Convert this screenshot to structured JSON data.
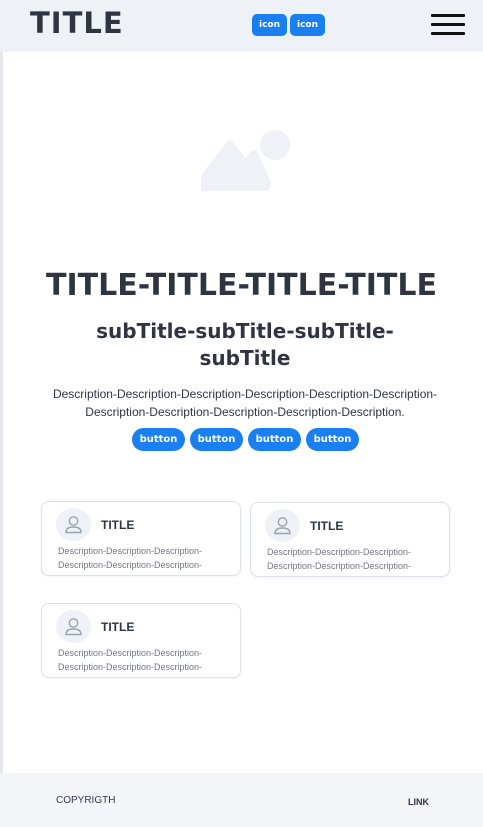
{
  "header": {
    "brand": "TITLE",
    "icon_buttons": [
      "icon",
      "icon"
    ]
  },
  "hero": {
    "image_icon": "image-placeholder-icon",
    "title": "TITLE-TITLE-TITLE-TITLE",
    "subtitle": "subTitle-subTitle-subTitle-subTitle",
    "description": "Description-Description-Description-Description-Description-Description-Description-Description-Description-Description-Description.",
    "buttons": [
      "button",
      "button",
      "button",
      "button"
    ]
  },
  "cards": [
    {
      "title": "TITLE",
      "desc_line1": "Description-Description-Description-",
      "desc_line2": "Description-Description-Description-"
    },
    {
      "title": "TITLE",
      "desc_line1": "Description-Description-Description-",
      "desc_line2": "Description-Description-Description-"
    },
    {
      "title": "TITLE",
      "desc_line1": "Description-Description-Description-",
      "desc_line2": "Description-Description-Description-"
    }
  ],
  "footer": {
    "copyright": "COPYRIGTH",
    "link": "LINK"
  },
  "colors": {
    "accent": "#1a7ff0",
    "header_bg": "#eef1f5",
    "text_dark": "#2e3540"
  }
}
